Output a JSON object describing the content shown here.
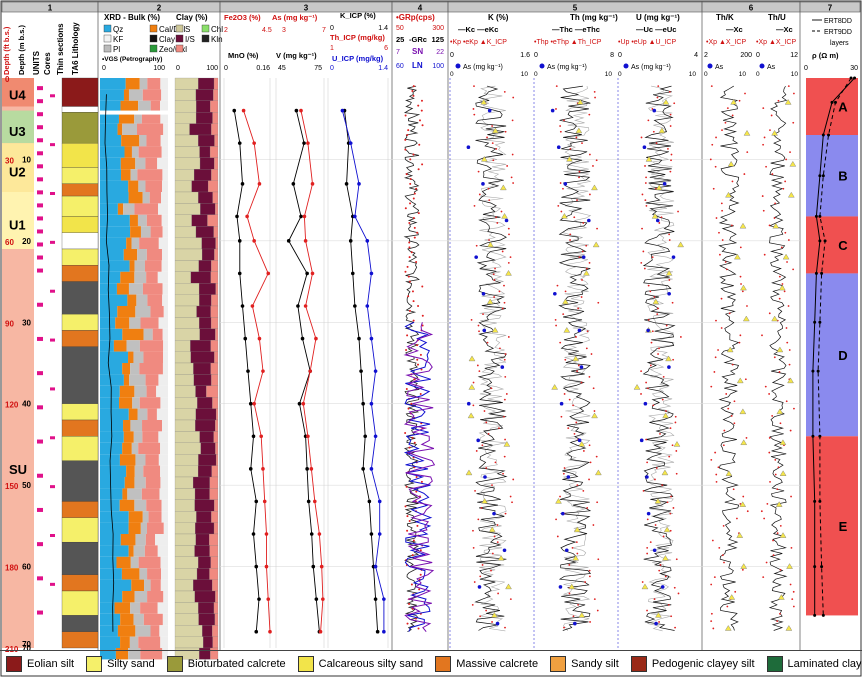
{
  "panel_numbers": [
    "1",
    "2",
    "3",
    "4",
    "5",
    "6",
    "7"
  ],
  "panel1": {
    "headers": [
      "Depth (ft b.s.)",
      "Depth (m b.s.)",
      "UNITS",
      "Cores",
      "Thin sections",
      "TA6 Lithology"
    ],
    "depth_ft_ticks": [
      "0",
      "30",
      "60",
      "90",
      "120",
      "150",
      "180",
      "210"
    ],
    "depth_m_ticks": [
      "10",
      "20",
      "30",
      "40",
      "50",
      "60",
      "70"
    ],
    "units": [
      "U4",
      "U3",
      "U2",
      "U1",
      "SU"
    ]
  },
  "panel2": {
    "xrd_title": "XRD - Bulk (%)",
    "xrd_legend": [
      "Qz",
      "Cal/Dol",
      "KF",
      "Clay",
      "Pl",
      "Zeo/Ox"
    ],
    "vgs": "VGS (Petrography)",
    "xrd_axis": [
      "0",
      "100"
    ],
    "clay_title": "Clay (%)",
    "clay_legend": [
      "S",
      "Chl",
      "I/S",
      "Kln",
      "I"
    ],
    "clay_axis": [
      "0",
      "100"
    ]
  },
  "panel3": {
    "fe2o3": "Fe2O3 (%)",
    "as_label": "As (mg kg⁻¹)",
    "fe_as_ticks": [
      "2",
      "4.5",
      "3",
      "7"
    ],
    "k_icp": "K_ICP (%)",
    "k_ticks": [
      "0",
      "1.4"
    ],
    "th_icp": "Th_ICP (mg/kg)",
    "th_ticks": [
      "1",
      "6"
    ],
    "mno": "MnO (%)",
    "mno_ticks": [
      "0",
      "0.16"
    ],
    "v": "V (mg kg⁻¹)",
    "v_ticks": [
      "45",
      "75"
    ],
    "u_icp": "U_ICP (mg/kg)",
    "u_ticks": [
      "0",
      "1.4"
    ]
  },
  "panel4": {
    "grp": "GRp(cps)",
    "grp_ticks": [
      "50",
      "300"
    ],
    "grc": "-GRc",
    "grc_ticks": [
      "25",
      "125"
    ],
    "sn": "SN",
    "ln": "LN",
    "sn_ln_ticks": [
      "7",
      "22",
      "60",
      "100"
    ]
  },
  "panel5": {
    "k_title": "K (%)",
    "k_ticks": [
      "0",
      "1.6"
    ],
    "k_legend": [
      "—Kc",
      "—eKc",
      "•Kp",
      "•eKp",
      "▲K_ICP"
    ],
    "as_label": "As (mg kg⁻¹)",
    "as_ticks": [
      "0",
      "10",
      "0",
      "10",
      "0",
      "10"
    ],
    "th_title": "Th (mg kg⁻¹)",
    "th_ticks": [
      "0",
      "8"
    ],
    "th_legend": [
      "—Thc",
      "—eThc",
      "•Thp",
      "•eThp",
      "▲Th_ICP"
    ],
    "u_title": "U (mg kg⁻¹)",
    "u_ticks": [
      "0",
      "4"
    ],
    "u_legend": [
      "—Uc",
      "—eUc",
      "•Up",
      "•eUp",
      "▲U_ICP"
    ]
  },
  "panel6": {
    "thk": "Th/K",
    "thu": "Th/U",
    "thk_ticks": [
      "2",
      "200"
    ],
    "thu_ticks": [
      "0",
      "12"
    ],
    "legend": [
      "—Xc",
      "•Xp",
      "▲X_ICP"
    ],
    "as_label": "As",
    "as_ticks": [
      "0",
      "10",
      "0",
      "10"
    ]
  },
  "panel7": {
    "legend": [
      "ERT8DD",
      "ERT9DD",
      "layers"
    ],
    "rho": "ρ (Ω m)",
    "rho_ticks": [
      "0",
      "30"
    ],
    "layers": [
      "A",
      "B",
      "C",
      "D",
      "E"
    ]
  },
  "lithology_legend": [
    {
      "label": "Eolian silt",
      "color": "#8b1a1a"
    },
    {
      "label": "Silty sand",
      "color": "#f5f06a"
    },
    {
      "label": "Bioturbated calcrete",
      "color": "#9a9a3a"
    },
    {
      "label": "Calcareous silty sand",
      "color": "#f2e44a"
    },
    {
      "label": "Massive calcrete",
      "color": "#e2761f"
    },
    {
      "label": "Sandy silt",
      "color": "#f0a040"
    },
    {
      "label": "Pedogenic clayey silt",
      "color": "#9a2a18"
    },
    {
      "label": "Laminated clayey silt",
      "color": "#1e6b3a"
    }
  ],
  "chart_data": {
    "type": "line",
    "depth_axis_m": [
      0,
      70
    ],
    "depth_axis_ft": [
      0,
      210
    ],
    "ert_layers": [
      {
        "name": "A",
        "top_m": 0,
        "bottom_m": 7,
        "color": "#f05050"
      },
      {
        "name": "B",
        "top_m": 7,
        "bottom_m": 17,
        "color": "#8a8aee"
      },
      {
        "name": "C",
        "top_m": 17,
        "bottom_m": 24,
        "color": "#f05050"
      },
      {
        "name": "D",
        "top_m": 24,
        "bottom_m": 44,
        "color": "#8a8aee"
      },
      {
        "name": "E",
        "top_m": 44,
        "bottom_m": 66,
        "color": "#f05050"
      }
    ],
    "series": [
      {
        "name": "Fe2O3 (%)",
        "depth_m": [
          4,
          8,
          13,
          17,
          20,
          24,
          28,
          32,
          36,
          40,
          44,
          48,
          52,
          56,
          60,
          64,
          68
        ],
        "values": [
          3.0,
          3.6,
          3.9,
          3.2,
          3.6,
          4.4,
          3.5,
          3.9,
          4.1,
          3.6,
          4.0,
          4.1,
          4.2,
          4.3,
          4.3,
          4.4,
          4.5
        ]
      },
      {
        "name": "As (mg kg⁻¹)",
        "depth_m": [
          4,
          8,
          13,
          17,
          20,
          24,
          28,
          32,
          36,
          40,
          44,
          48,
          52,
          56,
          60,
          64,
          68
        ],
        "values": [
          5.0,
          5.6,
          6.0,
          5.3,
          5.4,
          6.0,
          5.4,
          6.3,
          5.8,
          5.2,
          5.6,
          5.9,
          6.2,
          6.6,
          6.8,
          6.9,
          6.7
        ]
      },
      {
        "name": "MnO (%)",
        "depth_m": [
          4,
          8,
          13,
          17,
          20,
          24,
          28,
          32,
          36,
          40,
          44,
          48,
          52,
          56,
          60,
          64,
          68
        ],
        "values": [
          0.03,
          0.05,
          0.06,
          0.04,
          0.05,
          0.05,
          0.06,
          0.07,
          0.08,
          0.09,
          0.1,
          0.09,
          0.11,
          0.1,
          0.11,
          0.12,
          0.11
        ]
      },
      {
        "name": "V (mg kg⁻¹)",
        "depth_m": [
          4,
          8,
          13,
          17,
          20,
          24,
          28,
          32,
          36,
          40,
          44,
          48,
          52,
          56,
          60,
          64,
          68
        ],
        "values": [
          57,
          62,
          55,
          60,
          52,
          64,
          58,
          61,
          66,
          59,
          63,
          64,
          65,
          67,
          68,
          70,
          72
        ]
      },
      {
        "name": "K_ICP (%)",
        "depth_m": [
          4,
          8,
          13,
          17,
          20,
          24,
          28,
          32,
          36,
          40,
          44,
          48,
          52,
          56,
          60,
          64,
          68
        ],
        "values": [
          0.35,
          0.45,
          0.4,
          0.55,
          0.5,
          0.55,
          0.6,
          0.7,
          0.75,
          0.8,
          0.85,
          0.8,
          0.95,
          1.0,
          1.05,
          1.1,
          1.15
        ]
      },
      {
        "name": "U_ICP (mg/kg)",
        "depth_m": [
          4,
          8,
          13,
          17,
          20,
          24,
          28,
          32,
          36,
          40,
          44,
          48,
          52,
          56,
          60,
          64,
          68
        ],
        "values": [
          0.3,
          0.5,
          0.7,
          0.6,
          0.9,
          1.0,
          0.9,
          1.0,
          1.1,
          1.0,
          1.1,
          1.0,
          1.2,
          1.2,
          1.1,
          1.3,
          1.3
        ]
      },
      {
        "name": "ERT8DD",
        "depth_m": [
          0,
          3,
          7,
          12,
          17,
          20,
          24,
          30,
          36,
          44,
          52,
          60,
          66
        ],
        "values": [
          28,
          15,
          10,
          8,
          6,
          8,
          6,
          5,
          4,
          4,
          5,
          5,
          5
        ]
      },
      {
        "name": "ERT9DD",
        "depth_m": [
          0,
          3,
          7,
          12,
          17,
          20,
          24,
          30,
          36,
          44,
          52,
          60,
          66
        ],
        "values": [
          26,
          17,
          13,
          10,
          8,
          11,
          9,
          8,
          7,
          8,
          8,
          9,
          10
        ]
      }
    ]
  }
}
